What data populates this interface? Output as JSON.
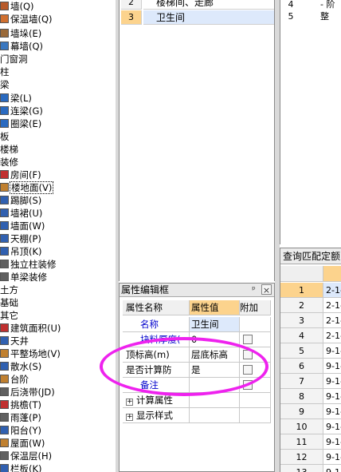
{
  "tree": {
    "items": [
      {
        "label": "墙(Q)",
        "indent": 10,
        "icon": "wall-icon",
        "color": "#b85a2a"
      },
      {
        "label": "保温墙(Q)",
        "indent": 10,
        "icon": "insulation-wall-icon",
        "color": "#d07030"
      },
      {
        "label": "墙垛(E)",
        "indent": 10,
        "icon": "wall-pier-icon",
        "color": "#9a6a3a"
      },
      {
        "label": "幕墙(Q)",
        "indent": 10,
        "icon": "curtain-wall-icon",
        "color": "#3a78c0"
      },
      {
        "label": "门窗洞",
        "indent": 0,
        "icon": "",
        "color": ""
      },
      {
        "label": "柱",
        "indent": 0,
        "icon": "",
        "color": ""
      },
      {
        "label": "梁",
        "indent": 0,
        "icon": "",
        "color": ""
      },
      {
        "label": "梁(L)",
        "indent": 10,
        "icon": "beam-icon",
        "color": "#2a6ac0"
      },
      {
        "label": "连梁(G)",
        "indent": 10,
        "icon": "link-beam-icon",
        "color": "#2a6ac0"
      },
      {
        "label": "圈梁(E)",
        "indent": 10,
        "icon": "ring-beam-icon",
        "color": "#2a6ac0"
      },
      {
        "label": "板",
        "indent": 0,
        "icon": "",
        "color": ""
      },
      {
        "label": "楼梯",
        "indent": 0,
        "icon": "",
        "color": ""
      },
      {
        "label": "装修",
        "indent": 0,
        "icon": "",
        "color": ""
      },
      {
        "label": "房间(F)",
        "indent": 10,
        "icon": "room-icon",
        "color": "#c03030"
      },
      {
        "label": "楼地面(V)",
        "indent": 10,
        "icon": "floor-icon",
        "color": "#c08030",
        "selected": true
      },
      {
        "label": "踢脚(S)",
        "indent": 10,
        "icon": "skirting-icon",
        "color": "#3060b0"
      },
      {
        "label": "墙裙(U)",
        "indent": 10,
        "icon": "dado-icon",
        "color": "#3060b0"
      },
      {
        "label": "墙面(W)",
        "indent": 10,
        "icon": "wall-face-icon",
        "color": "#3060b0"
      },
      {
        "label": "天棚(P)",
        "indent": 10,
        "icon": "ceiling-icon",
        "color": "#3060b0"
      },
      {
        "label": "吊顶(K)",
        "indent": 10,
        "icon": "suspended-ceiling-icon",
        "color": "#3060b0"
      },
      {
        "label": "独立柱装修",
        "indent": 10,
        "icon": "column-finish-icon",
        "color": "#606060"
      },
      {
        "label": "单梁装修",
        "indent": 10,
        "icon": "beam-finish-icon",
        "color": "#606060"
      },
      {
        "label": "土方",
        "indent": 0,
        "icon": "",
        "color": ""
      },
      {
        "label": "基础",
        "indent": 0,
        "icon": "",
        "color": ""
      },
      {
        "label": "其它",
        "indent": 0,
        "icon": "",
        "color": ""
      },
      {
        "label": "建筑面积(U)",
        "indent": 10,
        "icon": "building-area-icon",
        "color": "#c03030"
      },
      {
        "label": "天井",
        "indent": 10,
        "icon": "patio-icon",
        "color": "#3060b0"
      },
      {
        "label": "平整场地(V)",
        "indent": 10,
        "icon": "site-leveling-icon",
        "color": "#c08030"
      },
      {
        "label": "散水(S)",
        "indent": 10,
        "icon": "apron-icon",
        "color": "#3060b0"
      },
      {
        "label": "台阶",
        "indent": 10,
        "icon": "steps-icon",
        "color": "#c08030"
      },
      {
        "label": "后浇带(JD)",
        "indent": 10,
        "icon": "post-cast-strip-icon",
        "color": "#606060"
      },
      {
        "label": "挑檐(T)",
        "indent": 10,
        "icon": "eave-icon",
        "color": "#c03030"
      },
      {
        "label": "雨蓬(P)",
        "indent": 10,
        "icon": "canopy-icon",
        "color": "#606060"
      },
      {
        "label": "阳台(Y)",
        "indent": 10,
        "icon": "balcony-icon",
        "color": "#3060b0"
      },
      {
        "label": "屋面(W)",
        "indent": 10,
        "icon": "roof-icon",
        "color": "#c08030"
      },
      {
        "label": "保温层(H)",
        "indent": 10,
        "icon": "insulation-layer-icon",
        "color": "#606060"
      },
      {
        "label": "栏板(K)",
        "indent": 10,
        "icon": "parapet-icon",
        "color": "#3060b0"
      }
    ]
  },
  "top_list": {
    "rows": [
      {
        "num": "2",
        "name": "楼梯间、走廊",
        "selected": false
      },
      {
        "num": "3",
        "name": "卫生间",
        "selected": true
      }
    ]
  },
  "prop_panel": {
    "title": "属性编辑框",
    "pin_glyph": "ᵖ",
    "close_glyph": "×",
    "headers": {
      "name": "属性名称",
      "value": "属性值",
      "add": "附加"
    },
    "rows": [
      {
        "name": "名称",
        "value": "卫生间",
        "blue": true,
        "has_check": false
      },
      {
        "name": "块料厚度(",
        "value": "0",
        "blue": true,
        "has_check": true
      },
      {
        "name": "顶标高(m)",
        "value": "层底标高",
        "blue": false,
        "has_check": true
      },
      {
        "name": "是否计算防",
        "value": "是",
        "blue": false,
        "has_check": true
      },
      {
        "name": "备注",
        "value": "",
        "blue": true,
        "has_check": true
      },
      {
        "name": "计算属性",
        "value": "",
        "blue": false,
        "has_check": false,
        "expand": "+"
      },
      {
        "name": "显示样式",
        "value": "",
        "blue": false,
        "has_check": false,
        "expand": "+"
      }
    ],
    "annotation_color": "#ee22ee"
  },
  "right_top": {
    "rows": [
      {
        "num": "4",
        "text": "- 阶"
      },
      {
        "num": "5",
        "text": "整"
      }
    ]
  },
  "right_bottom": {
    "title": "查询匹配定额",
    "rows": [
      {
        "num": "1",
        "code": "2-1-",
        "selected": true
      },
      {
        "num": "2",
        "code": "2-1-"
      },
      {
        "num": "3",
        "code": "2-1-"
      },
      {
        "num": "4",
        "code": "2-1-"
      },
      {
        "num": "5",
        "code": "9-1-"
      },
      {
        "num": "6",
        "code": "9-1-"
      },
      {
        "num": "7",
        "code": "9-1-"
      },
      {
        "num": "8",
        "code": "9-1-"
      },
      {
        "num": "9",
        "code": "9-1-"
      },
      {
        "num": "10",
        "code": "9-1-"
      },
      {
        "num": "11",
        "code": "9-1-"
      },
      {
        "num": "12",
        "code": "9-1-"
      },
      {
        "num": "13",
        "code": "9-1-"
      }
    ]
  }
}
